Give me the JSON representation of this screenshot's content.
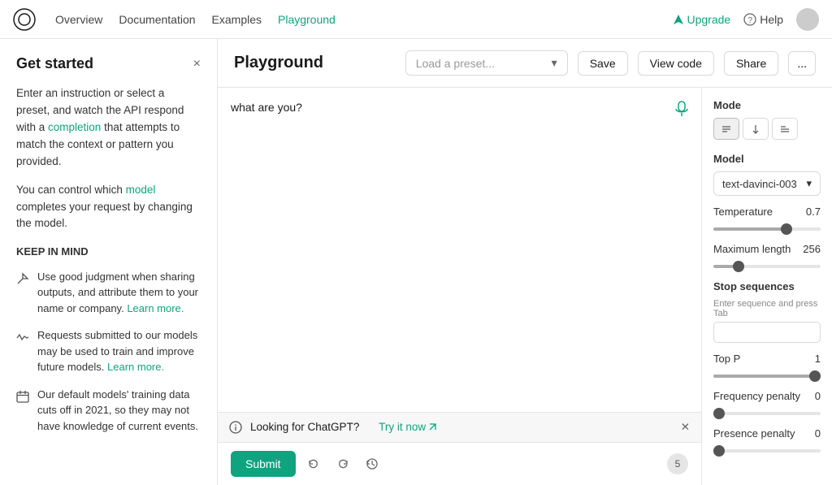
{
  "nav": {
    "links": [
      "Overview",
      "Documentation",
      "Examples",
      "Playground"
    ],
    "active_link": "Playground",
    "upgrade_label": "Upgrade",
    "help_label": "Help"
  },
  "sidebar": {
    "title": "Get started",
    "close_label": "×",
    "intro": "Enter an instruction or select a preset, and watch the API respond with a ",
    "completion_link": "completion",
    "intro2": " that attempts to match the context or pattern you provided.",
    "model_text": "You can control which ",
    "model_link": "model",
    "model_text2": " completes your request by changing the model.",
    "keep_in_mind": "KEEP IN MIND",
    "items": [
      {
        "text": "Use good judgment when sharing outputs, and attribute them to your name or company. ",
        "link": "Learn more.",
        "icon": "send"
      },
      {
        "text": "Requests submitted to our models may be used to train and improve future models. ",
        "link": "Learn more.",
        "icon": "activity"
      },
      {
        "text": "Our default models' training data cuts off in 2021, so they may not have knowledge of current events.",
        "link": null,
        "icon": "calendar"
      }
    ]
  },
  "playground": {
    "title": "Playground",
    "preset_placeholder": "Load a preset...",
    "save_label": "Save",
    "view_code_label": "View code",
    "share_label": "Share",
    "more_label": "..."
  },
  "text_area": {
    "content": "what are you?",
    "info_text": "Looking for ChatGPT?",
    "try_link": "Try it now",
    "submit_label": "Submit",
    "char_count": "5"
  },
  "settings": {
    "mode_label": "Mode",
    "model_label": "Model",
    "model_value": "text-davinci-003",
    "temperature_label": "Temperature",
    "temperature_value": "0.7",
    "temperature_pct": 70,
    "max_length_label": "Maximum length",
    "max_length_value": "256",
    "max_length_pct": 20,
    "stop_sequences_label": "Stop sequences",
    "stop_sequences_hint": "Enter sequence and press Tab",
    "top_p_label": "Top P",
    "top_p_value": "1",
    "top_p_pct": 100,
    "freq_penalty_label": "Frequency penalty",
    "freq_penalty_value": "0",
    "freq_penalty_pct": 0,
    "presence_penalty_label": "Presence penalty",
    "presence_penalty_value": "0",
    "presence_penalty_pct": 0
  }
}
